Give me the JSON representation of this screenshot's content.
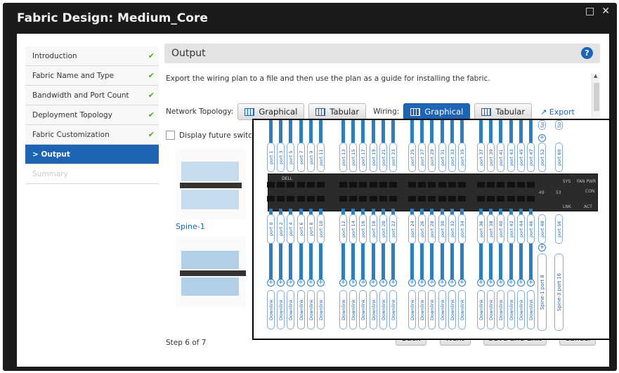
{
  "window": {
    "title": "Fabric Design: Medium_Core"
  },
  "nav": {
    "items": [
      {
        "label": "Introduction",
        "done": true
      },
      {
        "label": "Fabric Name and Type",
        "done": true
      },
      {
        "label": "Bandwidth and Port Count",
        "done": true
      },
      {
        "label": "Deployment Topology",
        "done": true
      },
      {
        "label": "Fabric Customization",
        "done": true
      },
      {
        "label": "> Output",
        "active": true
      },
      {
        "label": "Summary",
        "disabled": true
      }
    ]
  },
  "main": {
    "header": "Output",
    "description": "Export the wiring plan to a file and then use the plan as a guide for installing the fabric.",
    "network_topology_label": "Network Topology:",
    "wiring_label": "Wiring:",
    "graphical": "Graphical",
    "tabular": "Tabular",
    "export": "Export",
    "future_label": "Display future switc",
    "thumb_label": "Spine-1",
    "step": "Step 6 of 7"
  },
  "footer": {
    "back": "Back",
    "next": "Next",
    "save_exit": "Save and Exit",
    "cancel": "Cancel"
  },
  "overlay": {
    "top_ports": [
      "port 1",
      "port 3",
      "port 5",
      "port 7",
      "port 9",
      "port 11",
      "port 13",
      "port 15",
      "port 17",
      "port 19",
      "port 21",
      "port 23",
      "port 25",
      "port 27",
      "port 29",
      "port 31",
      "port 33",
      "port 35",
      "port 37",
      "port 39",
      "port 41",
      "port 43",
      "port 45",
      "port 47"
    ],
    "bottom_ports": [
      "port 0",
      "port 2",
      "port 4",
      "port 6",
      "port 8",
      "port 10",
      "port 12",
      "port 14",
      "port 16",
      "port 18",
      "port 20",
      "port 22",
      "port 24",
      "port 26",
      "port 28",
      "port 30",
      "port 32",
      "port 34",
      "port 36",
      "port 38",
      "port 40",
      "port 42",
      "port 44",
      "port 46"
    ],
    "top_uplinks": [
      "port 52",
      "port 60"
    ],
    "bottom_uplinks": [
      "port 48",
      "port 56"
    ],
    "top_edge_labels": [
      "Sp",
      "Sp"
    ],
    "downlink": "Downlink",
    "spine_labels": [
      "Spine-1 port 8",
      "Spine-3 port 16"
    ],
    "switch_texts": {
      "brand": "DELL",
      "u1": "49",
      "u2": "53",
      "u3": "SYS",
      "u4": "FAN PWR",
      "u5": "CON",
      "u6": "LNK",
      "u7": "ACT"
    }
  }
}
